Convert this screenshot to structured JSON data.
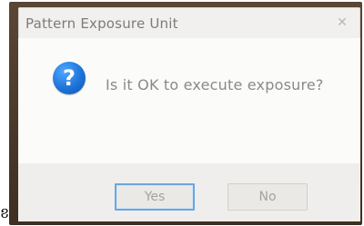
{
  "window": {
    "title": "Pattern Exposure Unit",
    "close_icon": "close-icon"
  },
  "dialog": {
    "icon": "question-icon",
    "icon_glyph": "?",
    "message": "Is it OK to execute exposure?"
  },
  "buttons": {
    "yes_label": "Yes",
    "no_label": "No"
  },
  "colors": {
    "frame": "#4a3a2a",
    "focus_border": "#6aa6e2",
    "icon_blue": "#1e74d8",
    "text_gray": "#8a8a8a"
  },
  "artifact": {
    "glyph": "ខ"
  }
}
